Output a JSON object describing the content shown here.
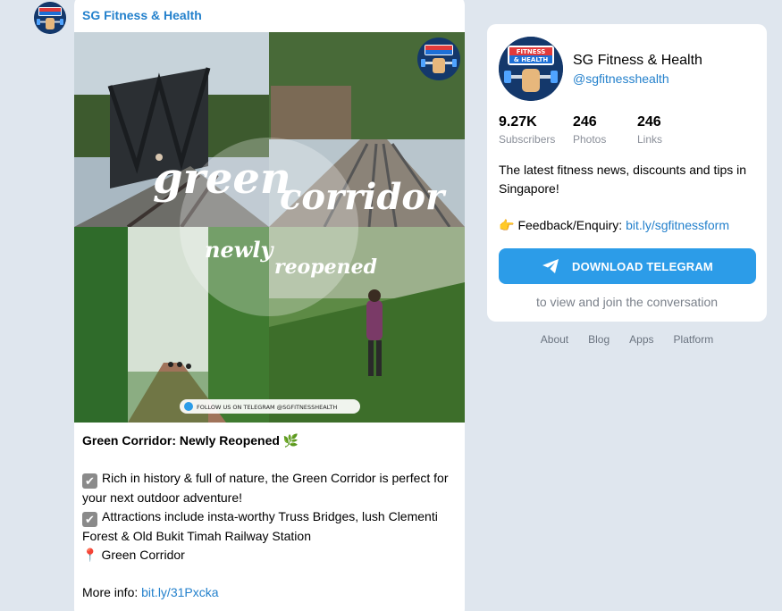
{
  "channel": {
    "name": "SG Fitness & Health",
    "handle": "@sgfitnesshealth",
    "logo_text_top": "FITNESS",
    "logo_text_bottom": "& HEALTH"
  },
  "post": {
    "photo": {
      "word_green": "green",
      "word_corridor": "corridor",
      "word_newly": "newly",
      "word_reopened": "reopened",
      "follow_banner": "FOLLOW US ON TELEGRAM @SGFITNESSHEALTH"
    },
    "title": "Green Corridor: Newly Reopened",
    "title_emoji": "🌿",
    "check_icon": "✔",
    "bullet1": "Rich in history & full of nature, the Green Corridor is perfect for your next outdoor adventure!",
    "bullet2": "Attractions include insta-worthy Truss Bridges, lush Clementi Forest & Old Bukit Timah Railway Station",
    "pin_icon": "📍",
    "location": "Green Corridor",
    "more_info_label": "More info: ",
    "more_info_link": "bit.ly/31Pxcka"
  },
  "info": {
    "stats": [
      {
        "value": "9.27K",
        "label": "Subscribers"
      },
      {
        "value": "246",
        "label": "Photos"
      },
      {
        "value": "246",
        "label": "Links"
      }
    ],
    "description": "The latest fitness news, discounts and tips in Singapore!",
    "feedback_icon": "👉",
    "feedback_label": "Feedback/Enquiry: ",
    "feedback_link": "bit.ly/sgfitnessform",
    "download_label": "DOWNLOAD TELEGRAM",
    "download_sub": "to view and join the conversation"
  },
  "footer": {
    "links": [
      "About",
      "Blog",
      "Apps",
      "Platform"
    ]
  },
  "colors": {
    "background": "#dfe6ee",
    "accent": "#2481cc",
    "button": "#2c9ce8",
    "logo_bg": "#14386b"
  }
}
